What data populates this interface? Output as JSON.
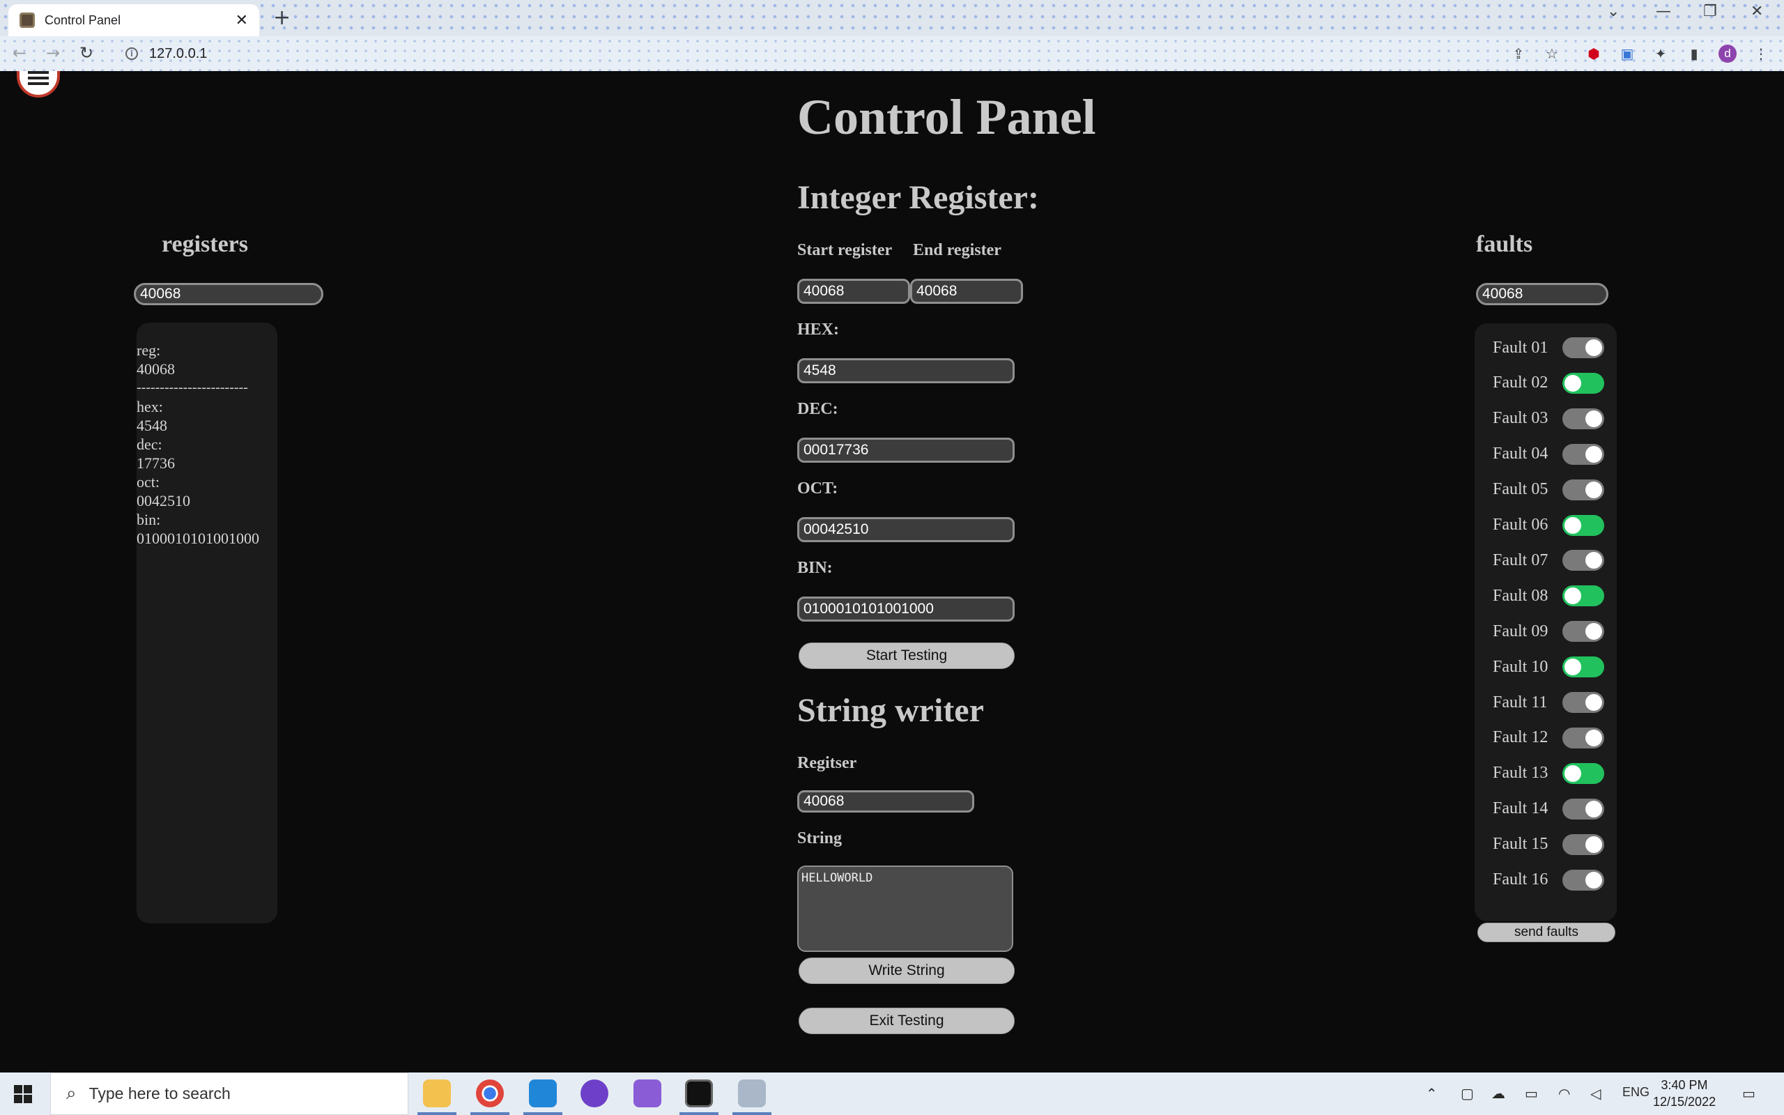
{
  "browser": {
    "tab_title": "Control Panel",
    "tab_close": "✕",
    "new_tab": "+",
    "url": "127.0.0.1",
    "profile_initial": "d",
    "window_controls": {
      "down": "⌄",
      "minimize": "—",
      "restore": "❐",
      "close": "✕"
    },
    "nav": {
      "back": "←",
      "forward": "→",
      "reload": "↻"
    }
  },
  "page": {
    "title": "Control Panel",
    "registers": {
      "heading": "registers",
      "input_value": "40068",
      "panel": {
        "reg_label": "reg:",
        "reg_value": "40068",
        "divider": "------------------------",
        "hex_label": "hex:",
        "hex_value": "4548",
        "dec_label": "dec:",
        "dec_value": "17736",
        "oct_label": "oct:",
        "oct_value": "0042510",
        "bin_label": "bin:",
        "bin_value": "0100010101001000"
      }
    },
    "integer_register": {
      "heading": "Integer Register:",
      "start_label": "Start register",
      "end_label": "End register",
      "start_value": "40068",
      "end_value": "40068",
      "hex_label": "HEX:",
      "hex_value": "4548",
      "dec_label": "DEC:",
      "dec_value": "00017736",
      "oct_label": "OCT:",
      "oct_value": "00042510",
      "bin_label": "BIN:",
      "bin_value": "0100010101001000",
      "start_button": "Start Testing"
    },
    "string_writer": {
      "heading": "String writer",
      "register_label": "Regitser",
      "register_value": "40068",
      "string_label": "String",
      "string_value": "HELLOWORLD",
      "write_button": "Write String",
      "exit_button": "Exit Testing"
    },
    "faults": {
      "heading": "faults",
      "input_value": "40068",
      "send_button": "send faults",
      "items": [
        {
          "label": "Fault 01",
          "on": false
        },
        {
          "label": "Fault 02",
          "on": true
        },
        {
          "label": "Fault 03",
          "on": false
        },
        {
          "label": "Fault 04",
          "on": false
        },
        {
          "label": "Fault 05",
          "on": false
        },
        {
          "label": "Fault 06",
          "on": true
        },
        {
          "label": "Fault 07",
          "on": false
        },
        {
          "label": "Fault 08",
          "on": true
        },
        {
          "label": "Fault 09",
          "on": false
        },
        {
          "label": "Fault 10",
          "on": true
        },
        {
          "label": "Fault 11",
          "on": false
        },
        {
          "label": "Fault 12",
          "on": false
        },
        {
          "label": "Fault 13",
          "on": true
        },
        {
          "label": "Fault 14",
          "on": false
        },
        {
          "label": "Fault 15",
          "on": false
        },
        {
          "label": "Fault 16",
          "on": false
        }
      ]
    }
  },
  "taskbar": {
    "search_placeholder": "Type here to search",
    "language": "ENG",
    "time": "3:40 PM",
    "date": "12/15/2022"
  },
  "colors": {
    "toggle_on": "#21c25e",
    "toggle_off": "#7a7a7a",
    "page_bg": "#0b0b0b",
    "heading": "#c9c9c9"
  }
}
